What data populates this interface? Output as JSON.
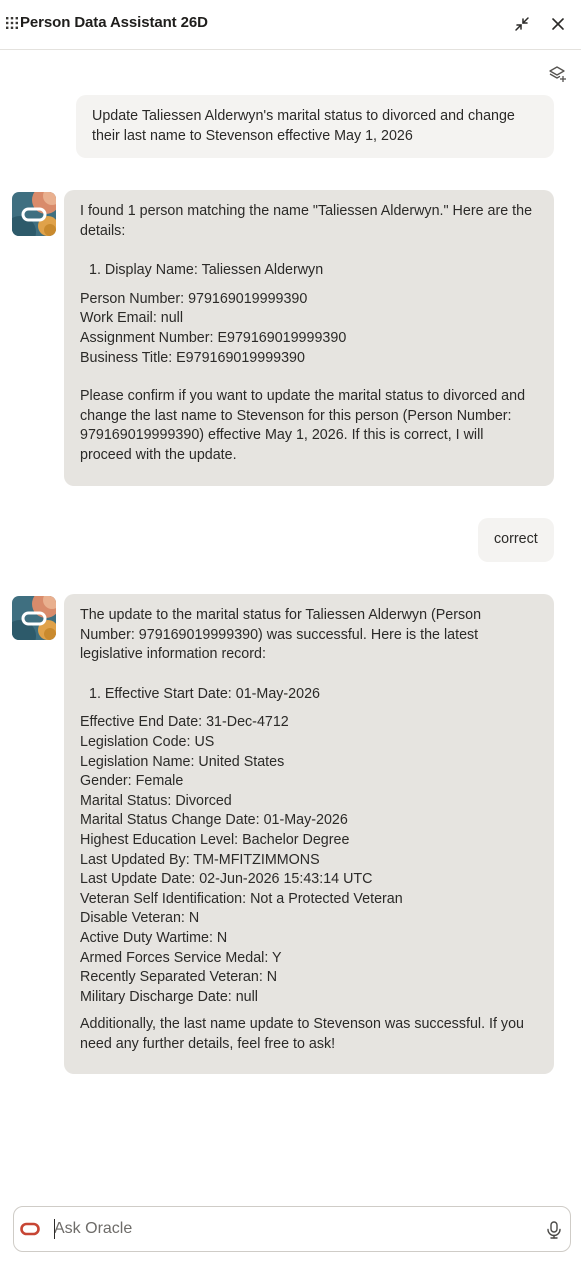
{
  "header": {
    "title": "Person Data Assistant 26D",
    "minimize_icon": "collapse-arrows-icon",
    "close_icon": "close-icon"
  },
  "toolbar": {
    "layers_icon": "layers-add-icon"
  },
  "messages": {
    "user1": {
      "line1": "Update Taliessen Alderwyn's marital status to divorced and change",
      "line2": "their last name to Stevenson effective May 1, 2026"
    },
    "bot1": {
      "intro": "I found 1 person matching the name \"Taliessen Alderwyn.\" Here are the details:",
      "list_item": "1. Display Name: Taliessen Alderwyn",
      "fields": [
        "Person Number: 979169019999390",
        "Work Email: null",
        "Assignment Number: E979169019999390",
        "Business Title: E979169019999390"
      ],
      "confirm": "Please confirm if you want to update the marital status to divorced and change the last name to Stevenson for this person (Person Number: 979169019999390) effective May 1, 2026. If this is correct, I will proceed with the update."
    },
    "user2": {
      "text": "correct"
    },
    "bot2": {
      "intro": "The update to the marital status for Taliessen Alderwyn (Person Number: 979169019999390) was successful. Here is the latest legislative information record:",
      "list_item": "1. Effective Start Date: 01-May-2026",
      "fields": [
        "Effective End Date: 31-Dec-4712",
        "Legislation Code: US",
        "Legislation Name: United States",
        "Gender: Female",
        "Marital Status: Divorced",
        "Marital Status Change Date: 01-May-2026",
        "Highest Education Level: Bachelor Degree",
        "Last Updated By: TM-MFITZIMMONS",
        "Last Update Date: 02-Jun-2026 15:43:14 UTC",
        "Veteran Self Identification: Not a Protected Veteran",
        "Disable Veteran: N",
        "Active Duty Wartime: N",
        "Armed Forces Service Medal: Y",
        "Recently Separated Veteran: N",
        "Military Discharge Date: null"
      ],
      "closing": "Additionally, the last name update to Stevenson was successful. If you need any further details, feel free to ask!"
    }
  },
  "composer": {
    "placeholder": "Ask Oracle",
    "logo_icon": "oracle-logo-icon",
    "mic_icon": "microphone-icon"
  },
  "colors": {
    "bot_bubble": "#e6e4e0",
    "user_bubble": "#f4f3f1",
    "oracle_red": "#c74634"
  }
}
